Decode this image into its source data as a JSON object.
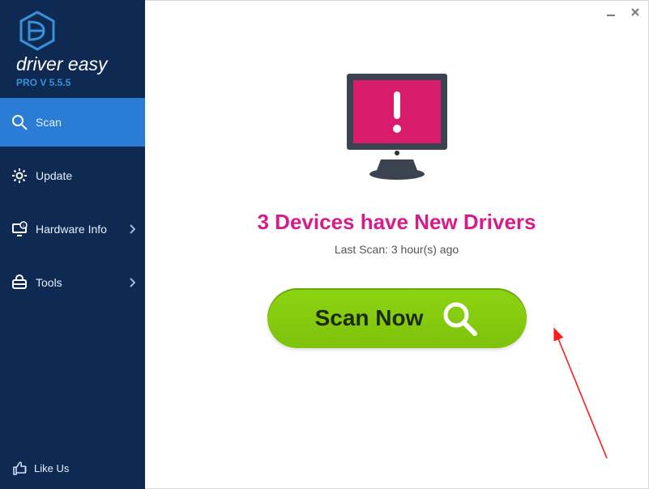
{
  "brand": {
    "name": "driver easy",
    "version_label": "PRO V 5.5.5"
  },
  "nav": {
    "scan": {
      "label": "Scan"
    },
    "update": {
      "label": "Update"
    },
    "hardware": {
      "label": "Hardware Info"
    },
    "tools": {
      "label": "Tools"
    }
  },
  "footer": {
    "like_label": "Like Us"
  },
  "main": {
    "headline": "3 Devices have New Drivers",
    "last_scan": "Last Scan: 3 hour(s) ago",
    "scan_button": "Scan Now"
  },
  "colors": {
    "accent_magenta": "#d81b8a",
    "sidebar_bg": "#0f2a52",
    "active_nav": "#2b7cd5",
    "button_green": "#8cd412"
  }
}
